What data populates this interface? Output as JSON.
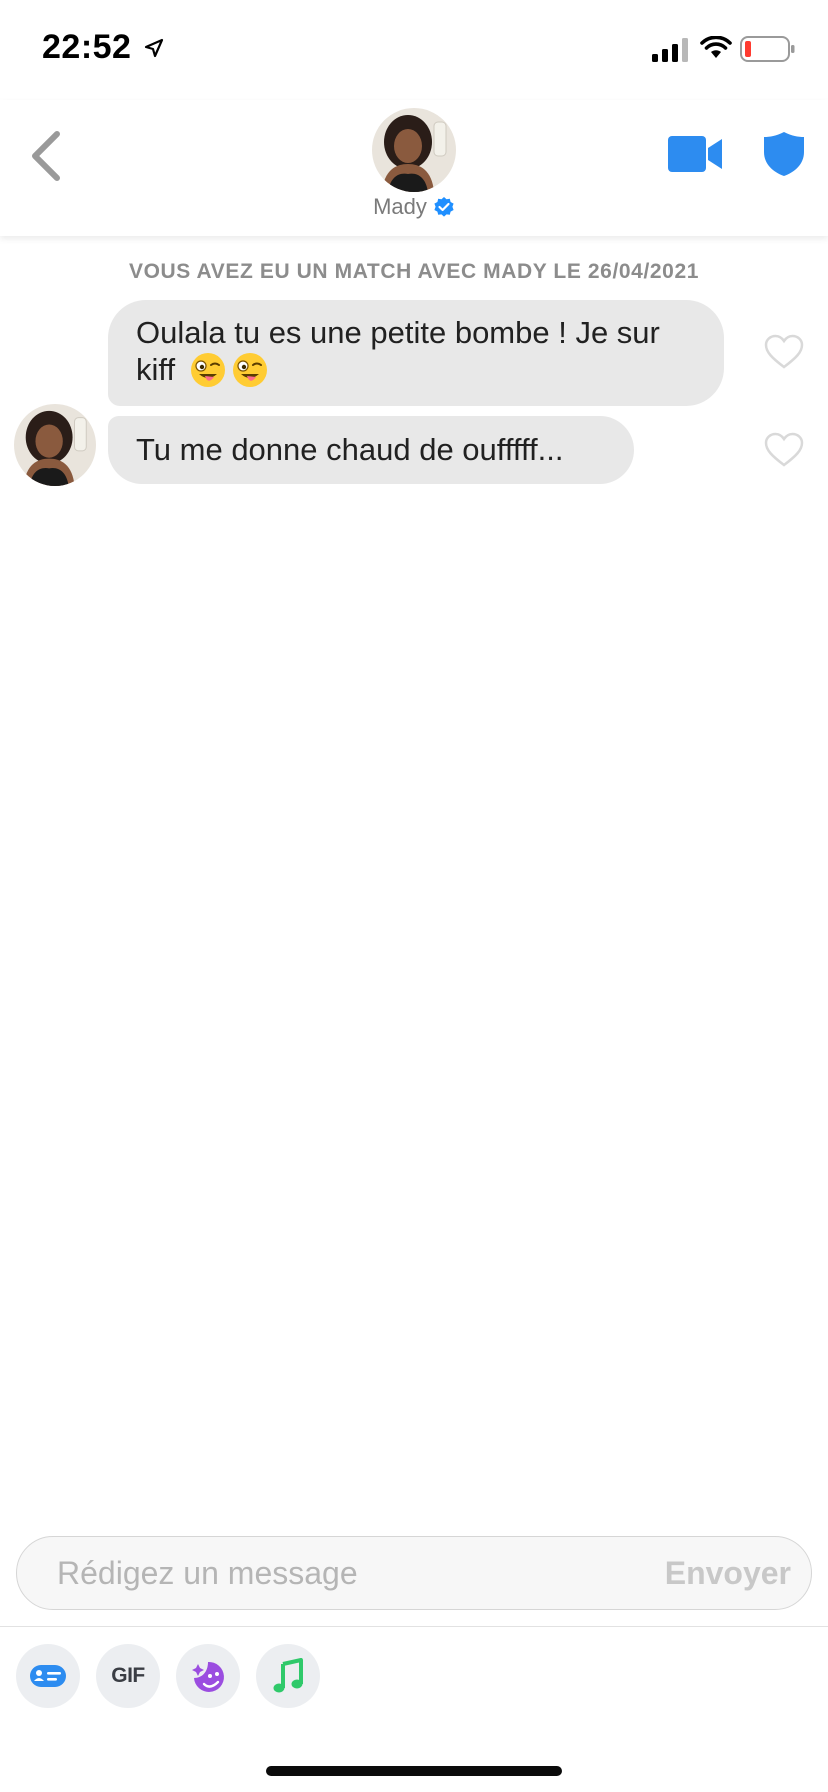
{
  "status_bar": {
    "time": "22:52",
    "icons": [
      "location-arrow-icon",
      "cellular-signal-icon",
      "wifi-icon",
      "battery-low-icon"
    ],
    "battery_color": "#ff3b30"
  },
  "header": {
    "back_icon": "chevron-left-icon",
    "name": "Mady",
    "verified_icon": "verified-badge-icon",
    "video_icon": "video-camera-icon",
    "shield_icon": "shield-icon",
    "accent_color": "#2d8cf0"
  },
  "chat": {
    "match_banner": "VOUS AVEZ EU UN MATCH AVEC MADY LE 26/04/2021",
    "messages": [
      {
        "text": "Oulala tu es une petite bombe ! Je sur kiff",
        "emoji": [
          "winking-tongue-emoji",
          "winking-tongue-emoji"
        ]
      },
      {
        "text": "Tu me donne chaud de oufffff..."
      }
    ],
    "bubble_color": "#e8e8e8"
  },
  "composer": {
    "placeholder": "Rédigez un message",
    "value": "",
    "send_label": "Envoyer"
  },
  "attachments": {
    "items": [
      "contact-card-icon",
      "GIF",
      "sticker-icon",
      "music-note-icon"
    ],
    "gif_label": "GIF"
  }
}
